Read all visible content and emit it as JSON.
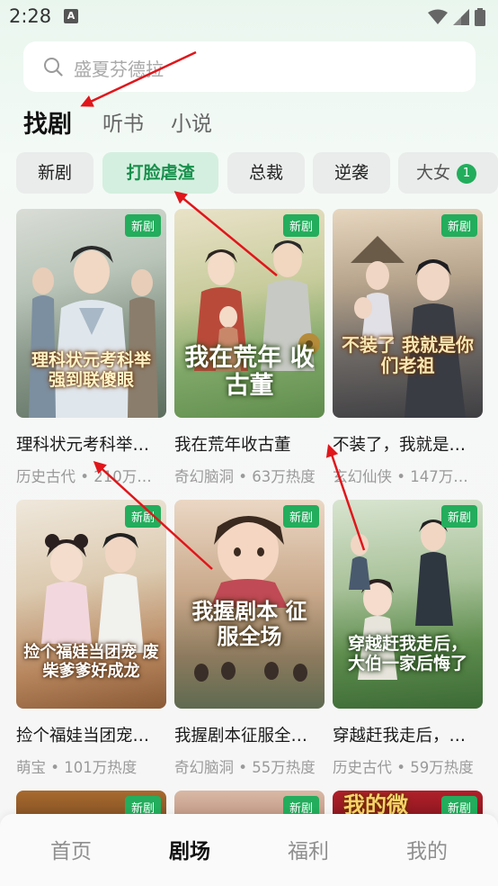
{
  "status_bar": {
    "time": "2:28",
    "app_icon_letter": "A"
  },
  "search": {
    "placeholder": "盛夏芬德拉"
  },
  "main_tabs": [
    {
      "label": "找剧",
      "active": true
    },
    {
      "label": "听书",
      "active": false
    },
    {
      "label": "小说",
      "active": false
    }
  ],
  "categories": [
    {
      "label": "新剧",
      "active": false
    },
    {
      "label": "打脸虐渣",
      "active": true
    },
    {
      "label": "总裁",
      "active": false
    },
    {
      "label": "逆袭",
      "active": false
    },
    {
      "label": "大女",
      "active": false
    }
  ],
  "category_badge": "1",
  "dramas": [
    {
      "tag": "新剧",
      "poster_text": "理科状元考科举 强到联傻眼",
      "title": "理科状元考科举…",
      "meta": "历史古代 • 210万…"
    },
    {
      "tag": "新剧",
      "poster_text": "我在荒年 收古董",
      "title": "我在荒年收古董",
      "meta": "奇幻脑洞 • 63万热度"
    },
    {
      "tag": "新剧",
      "poster_text": "不装了 我就是你们老祖",
      "title": "不装了，我就是…",
      "meta": "玄幻仙侠 • 147万…"
    },
    {
      "tag": "新剧",
      "poster_text": "捡个福娃当团宠 废柴爹爹好成龙",
      "title": "捡个福娃当团宠…",
      "meta": "萌宝 • 101万热度"
    },
    {
      "tag": "新剧",
      "poster_text": "我握剧本 征服全场",
      "title": "我握剧本征服全…",
      "meta": "奇幻脑洞 • 55万热度"
    },
    {
      "tag": "新剧",
      "poster_text": "穿越赶我走后， 大伯一家后悔了",
      "title": "穿越赶我走后，…",
      "meta": "历史古代 • 59万热度"
    },
    {
      "tag": "新剧",
      "poster_text": "",
      "title": "",
      "meta": ""
    },
    {
      "tag": "新剧",
      "poster_text": "",
      "title": "",
      "meta": ""
    },
    {
      "tag": "新剧",
      "poster_text": "我的微",
      "title": "",
      "meta": ""
    }
  ],
  "bottom_nav": [
    {
      "label": "首页",
      "active": false
    },
    {
      "label": "剧场",
      "active": true
    },
    {
      "label": "福利",
      "active": false
    },
    {
      "label": "我的",
      "active": false
    }
  ],
  "colors": {
    "accent_green": "#23ad5c",
    "chip_active_text": "#17904c",
    "chip_active_bg": "#d4efdf",
    "annotation_arrow": "#e0161b"
  },
  "icons": [
    "search-icon",
    "wifi-icon",
    "signal-icon",
    "battery-icon"
  ]
}
